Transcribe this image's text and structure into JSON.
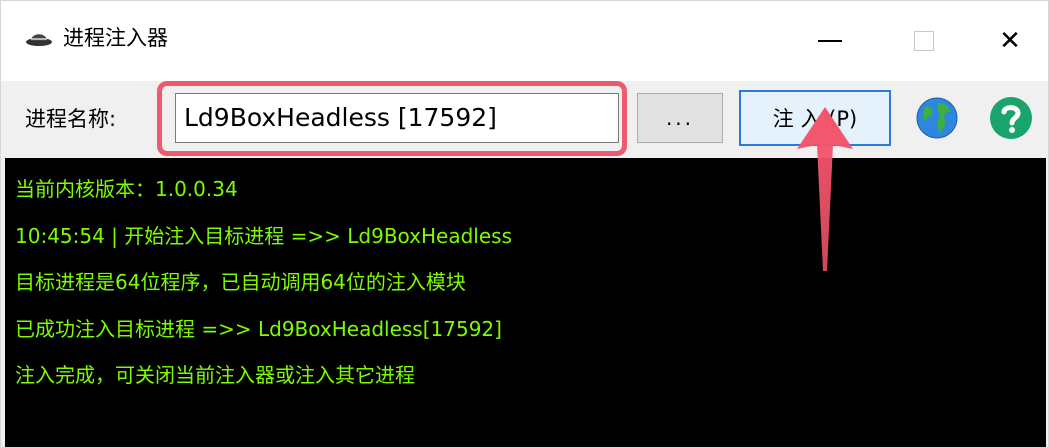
{
  "window": {
    "title": "进程注入器",
    "minimize_icon": "minimize-icon",
    "maximize_icon": "maximize-icon",
    "close_label": "✕"
  },
  "toolbar": {
    "process_label": "进程名称:",
    "process_value": "Ld9BoxHeadless [17592]",
    "browse_label": "...",
    "inject_label": "注 入 (P)",
    "globe_icon": "globe-icon",
    "help_icon": "help-icon"
  },
  "console": {
    "lines": [
      "当前内核版本：1.0.0.34",
      "10:45:54 | 开始注入目标进程 =>> Ld9BoxHeadless",
      "目标进程是64位程序，已自动调用64位的注入模块",
      "已成功注入目标进程 =>> Ld9BoxHeadless[17592]",
      "注入完成，可关闭当前注入器或注入其它进程"
    ],
    "text_color": "#7cfc00",
    "background": "#000000"
  },
  "annotation": {
    "highlight_color": "#ef5a6e"
  }
}
